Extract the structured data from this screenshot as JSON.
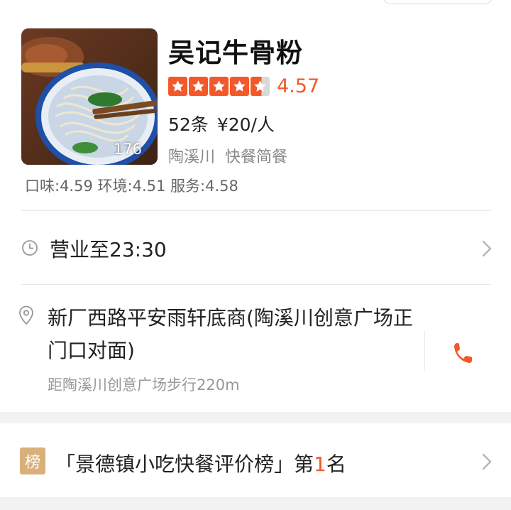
{
  "header": {
    "top_control": ""
  },
  "shop": {
    "photo_count": "176",
    "name": "吴记牛骨粉",
    "rating": 4.57,
    "rating_text": "4.57",
    "reviews": "52条",
    "price": "¥20/人",
    "area": "陶溪川",
    "category": "快餐简餐",
    "subscores": "口味:4.59 环境:4.51 服务:4.58"
  },
  "hours": {
    "text": "营业至23:30"
  },
  "address": {
    "text": "新厂西路平安雨轩底商(陶溪川创意广场正门口对面)",
    "distance": "距陶溪川创意广场步行220m"
  },
  "ranking": {
    "badge": "榜",
    "prefix": "「景德镇小吃快餐评价榜」第",
    "number": "1",
    "suffix": "名"
  },
  "colors": {
    "accent": "#f2582a",
    "badge": "#d9b07a",
    "muted": "#999999"
  },
  "icons": [
    "clock-icon",
    "location-pin-icon",
    "phone-icon",
    "chevron-right-icon",
    "star-icon"
  ]
}
